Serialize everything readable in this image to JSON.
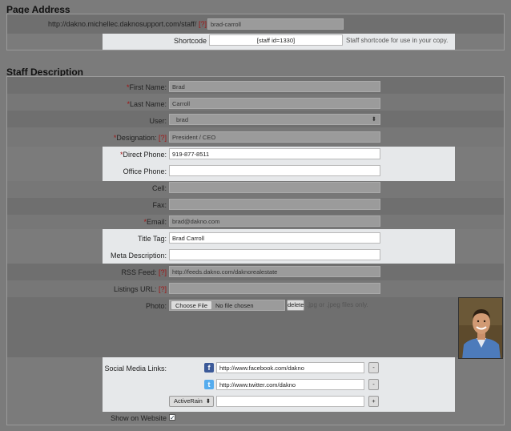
{
  "page_address": {
    "title": "Page Address",
    "url_prefix": "http://dakno.michellec.daknosupport.com/staff/",
    "help_marker": "[?]",
    "slug": "brad-carroll",
    "shortcode_label": "Shortcode",
    "shortcode_value": "[staff id=1330]",
    "shortcode_help": "Staff shortcode for use in your copy."
  },
  "staff_description": {
    "title": "Staff Description",
    "required_marker": "*",
    "help_marker": "[?]",
    "first_name_label": "First Name:",
    "first_name": "Brad",
    "last_name_label": "Last Name:",
    "last_name": "Carroll",
    "user_label": "User:",
    "user": "brad",
    "designation_label": "Designation:",
    "designation": "President / CEO",
    "direct_phone_label": "Direct Phone:",
    "direct_phone": "919-877-8511",
    "office_phone_label": "Office Phone:",
    "office_phone": "",
    "cell_label": "Cell:",
    "cell": "",
    "fax_label": "Fax:",
    "fax": "",
    "email_label": "Email:",
    "email": "brad@dakno.com",
    "title_tag_label": "Title Tag:",
    "title_tag": "Brad Carroll",
    "meta_description_label": "Meta Description:",
    "meta_description": "",
    "rss_feed_label": "RSS Feed:",
    "rss_feed": "http://feeds.dakno.com/daknorealestate",
    "listings_url_label": "Listings URL:",
    "listings_url": "",
    "photo_label": "Photo:",
    "choose_file": "Choose File",
    "no_file": "No file chosen",
    "delete": "delete",
    "photo_help": ".jpg or .jpeg files only.",
    "social_label": "Social Media Links:",
    "facebook_url": "http://www.facebook.com/dakno",
    "twitter_url": "http://www.twitter.com/dakno",
    "social_select": "ActiveRain",
    "social_new_url": "",
    "remove_label": "-",
    "add_label": "+",
    "show_on_website_label": "Show on Website",
    "show_on_website_check": "✓"
  },
  "icons": {
    "facebook": "f",
    "twitter": "t",
    "select_arrows": "⬍"
  },
  "colors": {
    "background": "#7b7b7b",
    "highlight_row": "#e6e8ea",
    "required": "#a01515",
    "facebook": "#3b5998",
    "twitter": "#55acee"
  }
}
